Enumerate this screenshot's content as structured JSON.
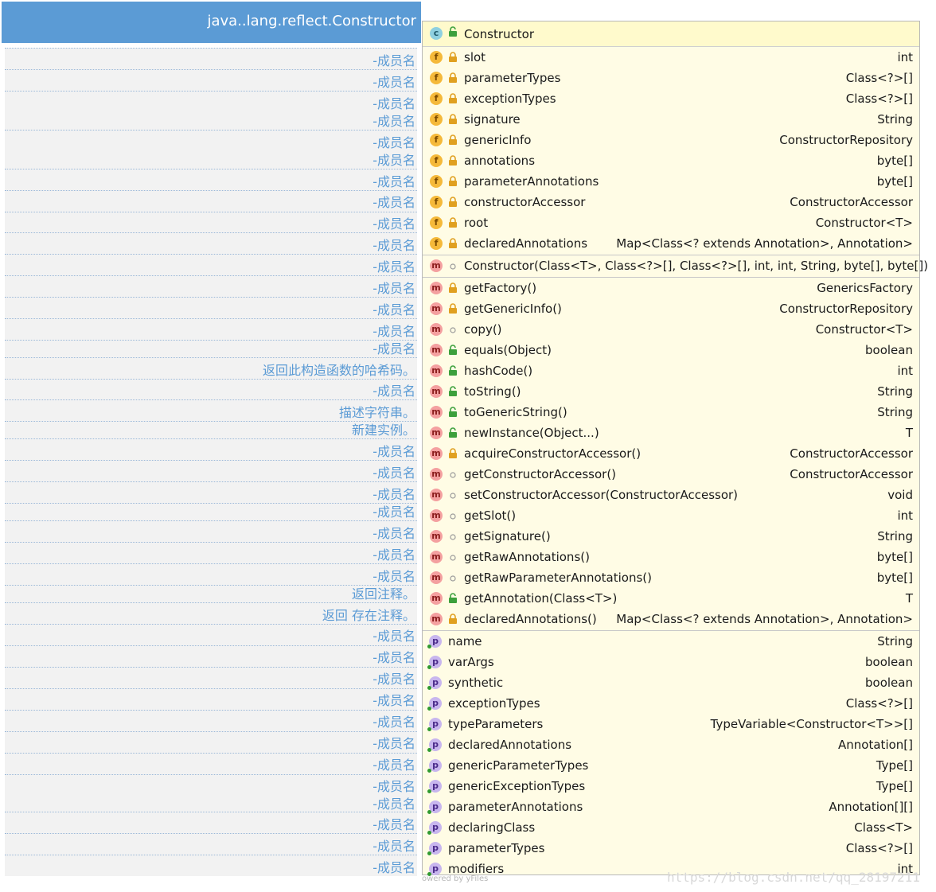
{
  "left_panel": {
    "title": "java..lang.reflect.Constructor",
    "rows": [
      "-成员名",
      "-成员名",
      "-成员名",
      "-成员名",
      "-成员名",
      "-成员名",
      "-成员名",
      "-成员名",
      "-成员名",
      "-成员名",
      "-成员名",
      "-成员名",
      "-成员名",
      "-成员名",
      "-成员名",
      "返回此构造函数的哈希码。",
      "-成员名",
      "描述字符串。",
      "新建实例。",
      "-成员名",
      "-成员名",
      "-成员名",
      "-成员名",
      "-成员名",
      "-成员名",
      "-成员名",
      "返回注释。",
      "返回 存在注释。",
      "-成员名",
      "-成员名",
      "-成员名",
      "-成员名",
      "-成员名",
      "-成员名",
      "-成员名",
      "-成员名",
      "-成员名",
      "-成员名",
      "-成员名",
      "-成员名"
    ]
  },
  "class_panel": {
    "class_name": "Constructor",
    "class_badge": "c",
    "fields": [
      {
        "name": "slot",
        "type": "int",
        "badge": "f",
        "visibility": "private"
      },
      {
        "name": "parameterTypes",
        "type": "Class<?>[]",
        "badge": "f",
        "visibility": "private"
      },
      {
        "name": "exceptionTypes",
        "type": "Class<?>[]",
        "badge": "f",
        "visibility": "private"
      },
      {
        "name": "signature",
        "type": "String",
        "badge": "f",
        "visibility": "private"
      },
      {
        "name": "genericInfo",
        "type": "ConstructorRepository",
        "badge": "f",
        "visibility": "private"
      },
      {
        "name": "annotations",
        "type": "byte[]",
        "badge": "f",
        "visibility": "private"
      },
      {
        "name": "parameterAnnotations",
        "type": "byte[]",
        "badge": "f",
        "visibility": "private"
      },
      {
        "name": "constructorAccessor",
        "type": "ConstructorAccessor",
        "badge": "f",
        "visibility": "private"
      },
      {
        "name": "root",
        "type": "Constructor<T>",
        "badge": "f",
        "visibility": "private"
      },
      {
        "name": "declaredAnnotations",
        "type": "Map<Class<? extends Annotation>, Annotation>",
        "badge": "f",
        "visibility": "private"
      }
    ],
    "constructors": [
      {
        "name": "Constructor(Class<T>, Class<?>[], Class<?>[], int, int, String, byte[], byte[])",
        "type": "",
        "badge": "m",
        "visibility": "package"
      }
    ],
    "methods": [
      {
        "name": "getFactory()",
        "type": "GenericsFactory",
        "badge": "m",
        "visibility": "private"
      },
      {
        "name": "getGenericInfo()",
        "type": "ConstructorRepository",
        "badge": "m",
        "visibility": "private"
      },
      {
        "name": "copy()",
        "type": "Constructor<T>",
        "badge": "m",
        "visibility": "package"
      },
      {
        "name": "equals(Object)",
        "type": "boolean",
        "badge": "m",
        "visibility": "public"
      },
      {
        "name": "hashCode()",
        "type": "int",
        "badge": "m",
        "visibility": "public"
      },
      {
        "name": "toString()",
        "type": "String",
        "badge": "m",
        "visibility": "public"
      },
      {
        "name": "toGenericString()",
        "type": "String",
        "badge": "m",
        "visibility": "public"
      },
      {
        "name": "newInstance(Object...)",
        "type": "T",
        "badge": "m",
        "visibility": "public"
      },
      {
        "name": "acquireConstructorAccessor()",
        "type": "ConstructorAccessor",
        "badge": "m",
        "visibility": "private"
      },
      {
        "name": "getConstructorAccessor()",
        "type": "ConstructorAccessor",
        "badge": "m",
        "visibility": "package"
      },
      {
        "name": "setConstructorAccessor(ConstructorAccessor)",
        "type": "void",
        "badge": "m",
        "visibility": "package"
      },
      {
        "name": "getSlot()",
        "type": "int",
        "badge": "m",
        "visibility": "package"
      },
      {
        "name": "getSignature()",
        "type": "String",
        "badge": "m",
        "visibility": "package"
      },
      {
        "name": "getRawAnnotations()",
        "type": "byte[]",
        "badge": "m",
        "visibility": "package"
      },
      {
        "name": "getRawParameterAnnotations()",
        "type": "byte[]",
        "badge": "m",
        "visibility": "package"
      },
      {
        "name": "getAnnotation(Class<T>)",
        "type": "T",
        "badge": "m",
        "visibility": "public"
      },
      {
        "name": "declaredAnnotations()",
        "type": "Map<Class<? extends Annotation>, Annotation>",
        "badge": "m",
        "visibility": "private"
      }
    ],
    "properties": [
      {
        "name": "name",
        "type": "String",
        "badge": "p"
      },
      {
        "name": "varArgs",
        "type": "boolean",
        "badge": "p"
      },
      {
        "name": "synthetic",
        "type": "boolean",
        "badge": "p"
      },
      {
        "name": "exceptionTypes",
        "type": "Class<?>[]",
        "badge": "p"
      },
      {
        "name": "typeParameters",
        "type": "TypeVariable<Constructor<T>>[]",
        "badge": "p"
      },
      {
        "name": "declaredAnnotations",
        "type": "Annotation[]",
        "badge": "p"
      },
      {
        "name": "genericParameterTypes",
        "type": "Type[]",
        "badge": "p"
      },
      {
        "name": "genericExceptionTypes",
        "type": "Type[]",
        "badge": "p"
      },
      {
        "name": "parameterAnnotations",
        "type": "Annotation[][]",
        "badge": "p"
      },
      {
        "name": "declaringClass",
        "type": "Class<T>",
        "badge": "p"
      },
      {
        "name": "parameterTypes",
        "type": "Class<?>[]",
        "badge": "p"
      },
      {
        "name": "modifiers",
        "type": "int",
        "badge": "p"
      }
    ]
  },
  "watermarks": {
    "yfiles": "owered by yFiles",
    "blog": "https://blog.csdn.net/qq_28197211"
  },
  "colors": {
    "header_blue": "#5b9bd5",
    "left_text": "#5b9bd5",
    "row_bg": "#f2f2f2",
    "panel_bg": "#fffce5",
    "field_badge": "#f5b93a",
    "method_badge": "#f4a0a0",
    "property_badge": "#c8b6ee",
    "private_lock": "#e0a020",
    "public_lock": "#3ca03c"
  }
}
